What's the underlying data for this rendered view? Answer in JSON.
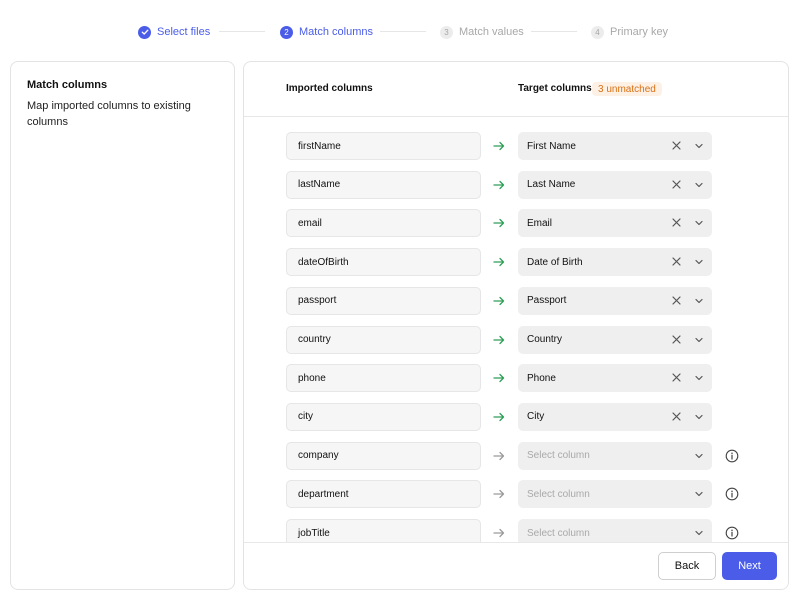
{
  "stepper": {
    "steps": [
      {
        "number": "",
        "label": "Select files",
        "state": "done"
      },
      {
        "number": "2",
        "label": "Match columns",
        "state": "active"
      },
      {
        "number": "3",
        "label": "Match values",
        "state": "pending"
      },
      {
        "number": "4",
        "label": "Primary key",
        "state": "pending"
      }
    ]
  },
  "sidebar": {
    "title": "Match columns",
    "description": "Map imported columns to existing columns"
  },
  "table": {
    "imported_header": "Imported columns",
    "target_header": "Target columns",
    "unmatched_badge": "3 unmatched",
    "rows": [
      {
        "source": "firstName",
        "target": "First Name",
        "matched": true
      },
      {
        "source": "lastName",
        "target": "Last Name",
        "matched": true
      },
      {
        "source": "email",
        "target": "Email",
        "matched": true
      },
      {
        "source": "dateOfBirth",
        "target": "Date of Birth",
        "matched": true
      },
      {
        "source": "passport",
        "target": "Passport",
        "matched": true
      },
      {
        "source": "country",
        "target": "Country",
        "matched": true
      },
      {
        "source": "phone",
        "target": "Phone",
        "matched": true
      },
      {
        "source": "city",
        "target": "City",
        "matched": true
      },
      {
        "source": "company",
        "target": "Select column",
        "matched": false
      },
      {
        "source": "department",
        "target": "Select column",
        "matched": false
      },
      {
        "source": "jobTitle",
        "target": "Select column",
        "matched": false
      }
    ]
  },
  "footer": {
    "back_label": "Back",
    "next_label": "Next"
  },
  "colors": {
    "accent": "#4a5ce8",
    "matched_arrow": "#2e9e57",
    "unmatched_arrow": "#9a9a9a",
    "badge_text": "#d97014",
    "badge_bg": "#fdf1e6"
  },
  "icons": {
    "done_step": "check-icon",
    "matched_arrow": "arrow-right-icon",
    "clear": "close-icon",
    "dropdown": "chevron-down-icon",
    "info": "info-icon"
  }
}
